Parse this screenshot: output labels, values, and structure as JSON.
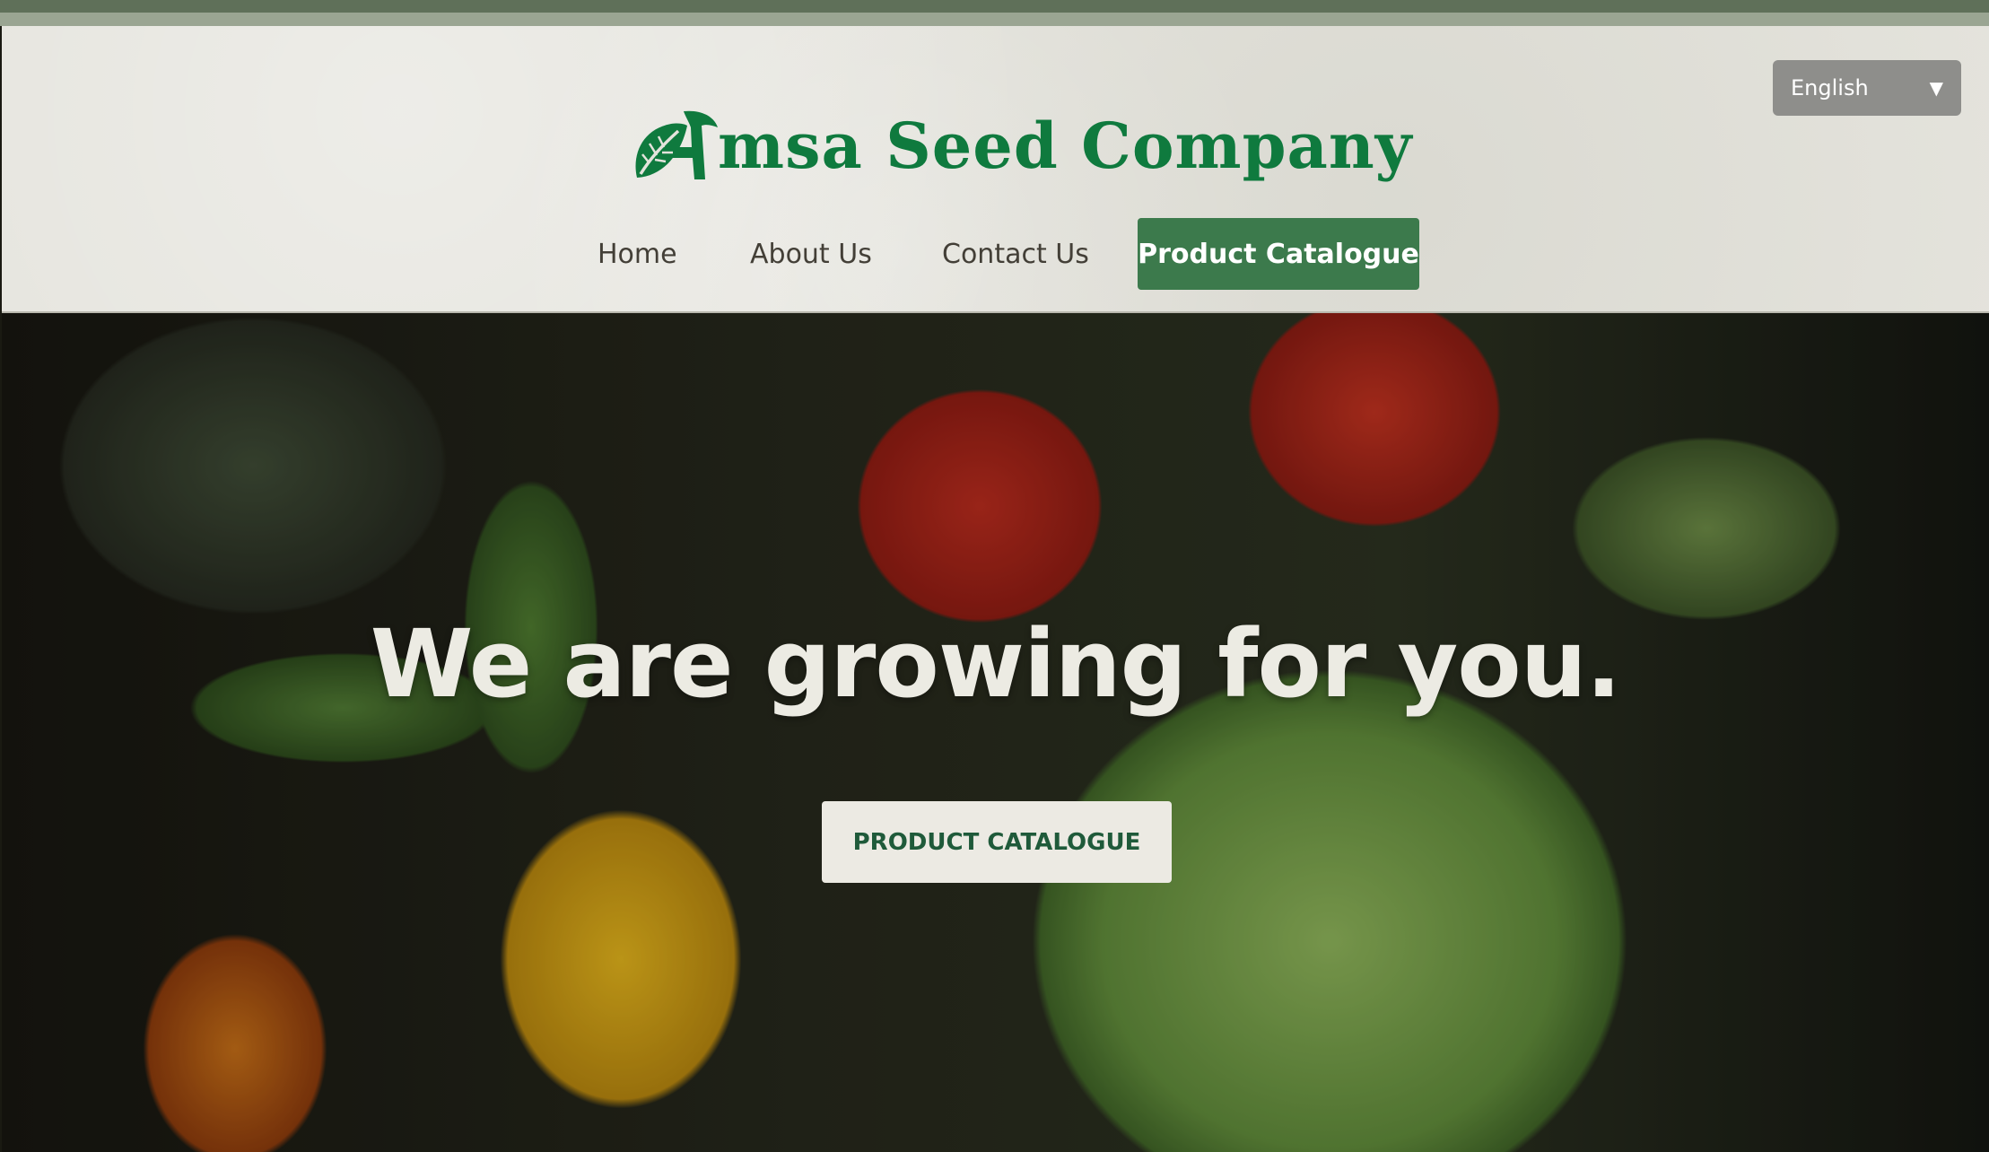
{
  "language_selector": {
    "selected": "English",
    "icon": "dropdown-arrow-icon"
  },
  "logo": {
    "text": "Amsa Seed Company",
    "text_rest": "msa Seed Company",
    "icon": "leaf-a-icon",
    "brand_color": "#0f7a3e"
  },
  "nav": {
    "items": [
      {
        "label": "Home"
      },
      {
        "label": "About Us"
      },
      {
        "label": "Contact Us"
      },
      {
        "label": "Product Catalogue",
        "active": true
      }
    ],
    "active_color": "#3c7a4c"
  },
  "hero": {
    "title": "We are growing for you.",
    "button_label": "PRODUCT CATALOGUE"
  }
}
